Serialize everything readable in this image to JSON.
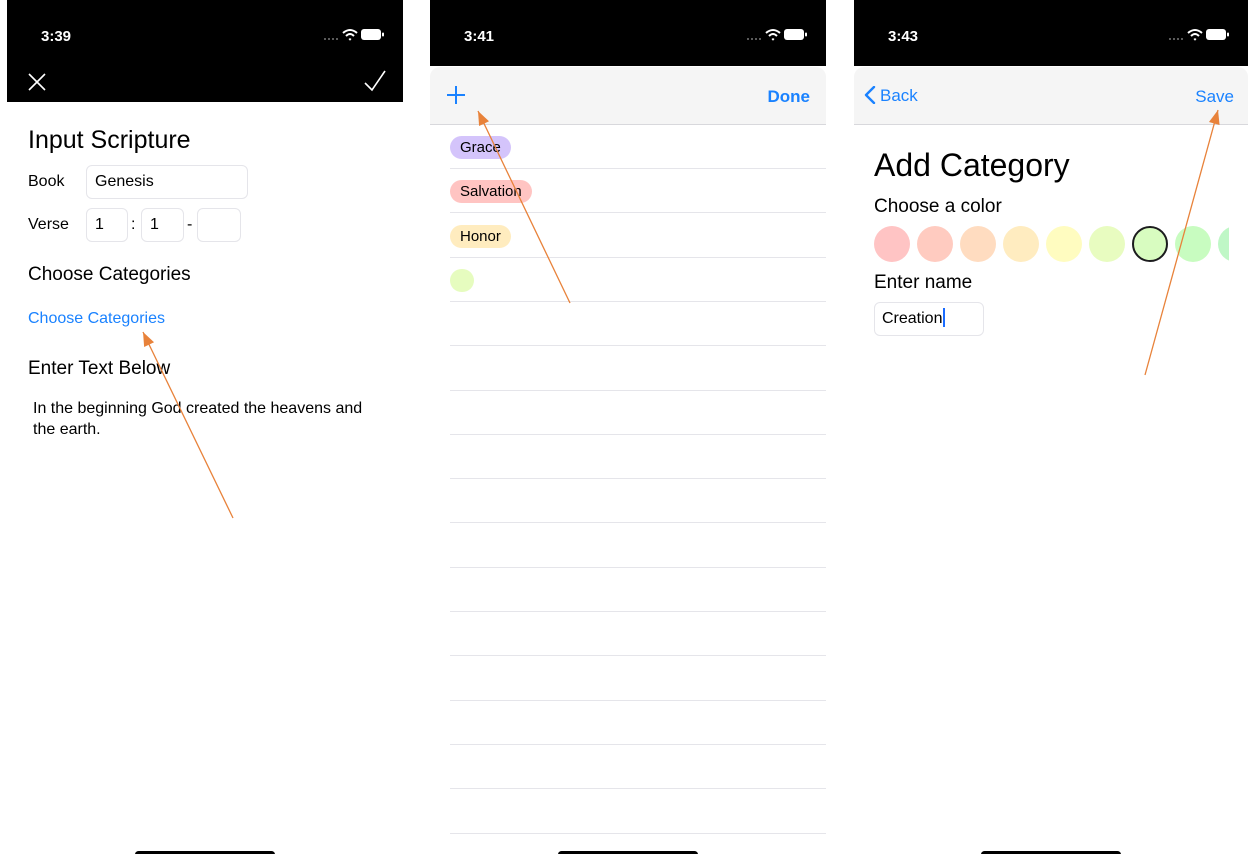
{
  "colors": {
    "accent": "#1a82ff",
    "annotation": "#e8823a"
  },
  "screen1": {
    "status_time": "3:39",
    "nav": {
      "close_icon": "close-icon",
      "confirm_icon": "checkmark-icon"
    },
    "title": "Input Scripture",
    "book_label": "Book",
    "book_value": "Genesis",
    "verse_label": "Verse",
    "verse_chapter": "1",
    "verse_separator": ":",
    "verse_start": "1",
    "verse_dash": "-",
    "verse_end": "",
    "categories_heading": "Choose Categories",
    "categories_link": "Choose Categories",
    "text_heading": "Enter Text Below",
    "text_body": "In the beginning God created the heavens and the earth."
  },
  "screen2": {
    "status_time": "3:41",
    "add_icon": "plus-icon",
    "done_label": "Done",
    "categories": [
      {
        "name": "Grace",
        "color": "#d4c4fb"
      },
      {
        "name": "Salvation",
        "color": "#ffc4c2"
      },
      {
        "name": "Honor",
        "color": "#ffecbf"
      },
      {
        "name": "",
        "color": "#e6fcbf"
      }
    ]
  },
  "screen3": {
    "status_time": "3:43",
    "back_label": "Back",
    "save_label": "Save",
    "title": "Add Category",
    "color_label": "Choose a color",
    "swatches": [
      "#ffc4c4",
      "#ffcbc0",
      "#ffdcc0",
      "#ffecc0",
      "#fffcc0",
      "#e8fcc0",
      "#d8fcc0",
      "#c8fcc0",
      "#bff7c6"
    ],
    "selected_swatch": 6,
    "name_label": "Enter name",
    "name_value": "Creation"
  }
}
